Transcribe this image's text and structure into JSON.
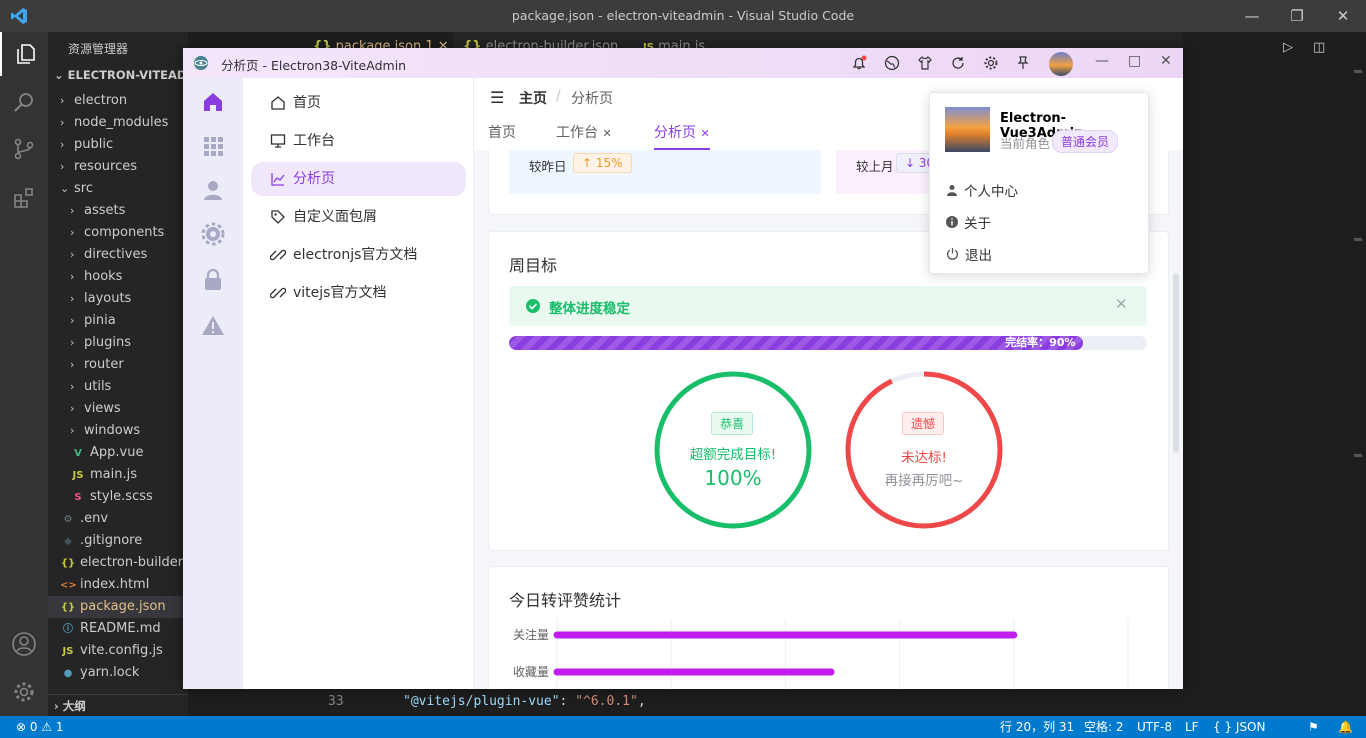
{
  "vscode": {
    "title": "package.json - electron-viteadmin - Visual Studio Code",
    "explorer_header": "资源管理器",
    "root_folder": "ELECTRON-VITEADMIN",
    "tree": [
      {
        "label": "electron",
        "kind": "folder",
        "open": false,
        "indent": 0
      },
      {
        "label": "node_modules",
        "kind": "folder",
        "open": false,
        "indent": 0
      },
      {
        "label": "public",
        "kind": "folder",
        "open": false,
        "indent": 0
      },
      {
        "label": "resources",
        "kind": "folder",
        "open": false,
        "indent": 0
      },
      {
        "label": "src",
        "kind": "folder",
        "open": true,
        "indent": 0
      },
      {
        "label": "assets",
        "kind": "folder",
        "open": false,
        "indent": 1
      },
      {
        "label": "components",
        "kind": "folder",
        "open": false,
        "indent": 1
      },
      {
        "label": "directives",
        "kind": "folder",
        "open": false,
        "indent": 1
      },
      {
        "label": "hooks",
        "kind": "folder",
        "open": false,
        "indent": 1
      },
      {
        "label": "layouts",
        "kind": "folder",
        "open": false,
        "indent": 1
      },
      {
        "label": "pinia",
        "kind": "folder",
        "open": false,
        "indent": 1
      },
      {
        "label": "plugins",
        "kind": "folder",
        "open": false,
        "indent": 1
      },
      {
        "label": "router",
        "kind": "folder",
        "open": false,
        "indent": 1
      },
      {
        "label": "utils",
        "kind": "folder",
        "open": false,
        "indent": 1
      },
      {
        "label": "views",
        "kind": "folder",
        "open": false,
        "indent": 1
      },
      {
        "label": "windows",
        "kind": "folder",
        "open": false,
        "indent": 1
      },
      {
        "label": "App.vue",
        "kind": "vue",
        "indent": 1
      },
      {
        "label": "main.js",
        "kind": "js",
        "indent": 1
      },
      {
        "label": "style.scss",
        "kind": "scss",
        "indent": 1
      },
      {
        "label": ".env",
        "kind": "gear",
        "indent": 0
      },
      {
        "label": ".gitignore",
        "kind": "git",
        "indent": 0
      },
      {
        "label": "electron-builder.json",
        "kind": "json",
        "indent": 0
      },
      {
        "label": "index.html",
        "kind": "html",
        "indent": 0
      },
      {
        "label": "package.json",
        "kind": "json",
        "indent": 0,
        "selected": true
      },
      {
        "label": "README.md",
        "kind": "info",
        "indent": 0
      },
      {
        "label": "vite.config.js",
        "kind": "js",
        "indent": 0
      },
      {
        "label": "yarn.lock",
        "kind": "yarn",
        "indent": 0
      }
    ],
    "outline_label": "大纲",
    "editor_tabs": [
      "package.json 1",
      "electron-builder.json",
      "main.js"
    ],
    "code_line_number": "33",
    "code_key": "\"@vitejs/plugin-vue\"",
    "code_colon": ": ",
    "code_value": "\"^6.0.1\"",
    "code_comma": ",",
    "status_left": "⊗ 0 ⚠ 1",
    "status_position": "行 20，列 31",
    "status_spaces": "空格: 2",
    "status_encoding": "UTF-8",
    "status_eol": "LF",
    "status_lang": "{ } JSON"
  },
  "app": {
    "window_title": "分析页 - Electron38-ViteAdmin",
    "menu": [
      {
        "label": "首页",
        "icon": "home-icon"
      },
      {
        "label": "工作台",
        "icon": "monitor-icon"
      },
      {
        "label": "分析页",
        "icon": "chart-line-icon",
        "active": true
      },
      {
        "label": "自定义面包屑",
        "icon": "tag-icon"
      },
      {
        "label": "electronjs官方文档",
        "icon": "link-icon"
      },
      {
        "label": "vitejs官方文档",
        "icon": "link-icon"
      }
    ],
    "breadcrumb": {
      "home": "主页",
      "sep": "/",
      "current": "分析页"
    },
    "view_tabs": [
      {
        "label": "首页",
        "closable": false
      },
      {
        "label": "工作台",
        "closable": true
      },
      {
        "label": "分析页",
        "closable": true,
        "active": true
      }
    ],
    "top_stats": {
      "left_label": "较昨日",
      "left_badge": "↑ 15%",
      "right_label": "较上月",
      "right_badge": "↓ 30"
    },
    "weekly": {
      "title": "周目标",
      "alert": "整体进度稳定",
      "progress_text": "完结率：90%",
      "progress_value": 0.9,
      "ring1": {
        "badge": "恭喜",
        "text": "超额完成目标!",
        "value": "100%",
        "fraction": 1.0
      },
      "ring2": {
        "badge": "遗憾",
        "text": "未达标!",
        "sub": "再接再厉吧~",
        "fraction": 0.93
      }
    },
    "bar_card": {
      "title": "今日转评赞统计"
    },
    "chart_data": {
      "type": "bar",
      "orientation": "horizontal",
      "categories": [
        "关注量",
        "收藏量"
      ],
      "values": [
        100,
        60
      ],
      "xlim": [
        0,
        125
      ],
      "grid": true
    },
    "user_menu": {
      "name": "Electron-Vue3Admin",
      "role_label": "当前角色",
      "role": "普通会员",
      "items": [
        {
          "label": "个人中心",
          "icon": "user-icon"
        },
        {
          "label": "关于",
          "icon": "info-icon"
        },
        {
          "label": "退出",
          "icon": "power-icon"
        }
      ]
    },
    "colors": {
      "accent": "#8a3ee0",
      "success": "#19be6b",
      "danger": "#f04848",
      "bar": "#c01cf0"
    }
  }
}
